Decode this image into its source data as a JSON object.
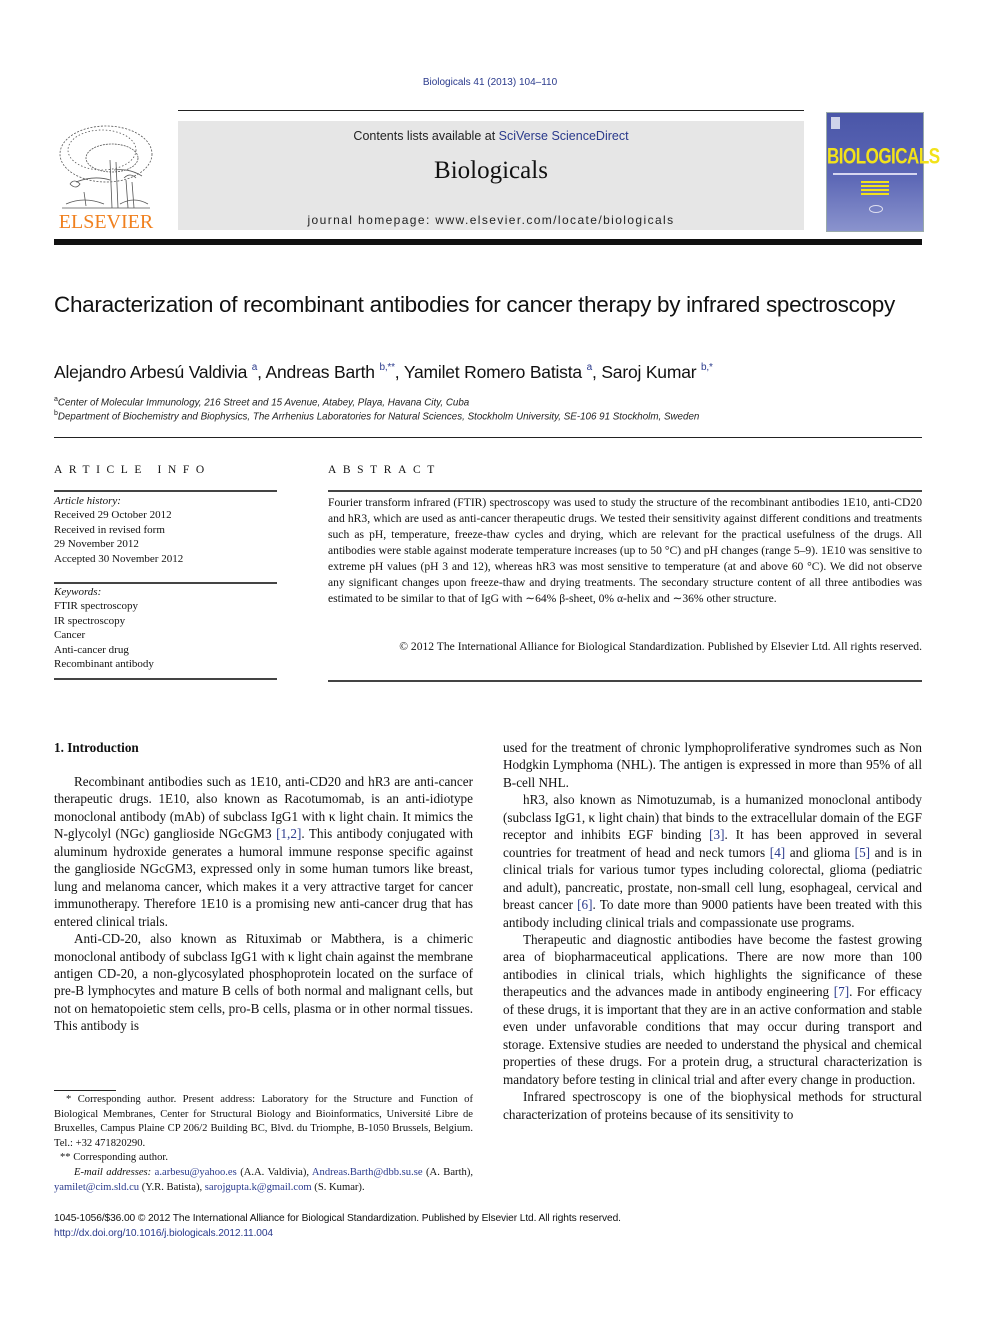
{
  "header": {
    "citation": "Biologicals 41 (2013) 104–110",
    "publisher_logo": {
      "icon": "elsevier-tree-icon",
      "wordmark": "ELSEVIER",
      "color": "#f0801e"
    },
    "contents_prefix": "Contents lists available at ",
    "contents_link": "SciVerse ScienceDirect",
    "journal_name": "Biologicals",
    "homepage": "journal homepage: www.elsevier.com/locate/biologicals",
    "cover": {
      "icon": "journal-cover-icon",
      "title": "BIOLOGICALS",
      "background": "#4a56a8",
      "title_color": "#f2e21a"
    }
  },
  "article": {
    "title": "Characterization of recombinant antibodies for cancer therapy by infrared spectroscopy",
    "authors": [
      {
        "name": "Alejandro Arbesú Valdivia",
        "sup": "a",
        "sep": ", "
      },
      {
        "name": "Andreas Barth",
        "sup": "b,**",
        "sep": ", "
      },
      {
        "name": "Yamilet Romero Batista",
        "sup": "a",
        "sep": ", "
      },
      {
        "name": "Saroj Kumar",
        "sup": "b,*",
        "sep": ""
      }
    ],
    "affiliations": [
      {
        "label": "a",
        "text": "Center of Molecular Immunology, 216 Street and 15 Avenue, Atabey, Playa, Havana City, Cuba"
      },
      {
        "label": "b",
        "text": "Department of Biochemistry and Biophysics, The Arrhenius Laboratories for Natural Sciences, Stockholm University, SE-106 91 Stockholm, Sweden"
      }
    ]
  },
  "article_info": {
    "heading": "ARTICLE INFO",
    "history_label": "Article history:",
    "history": [
      "Received 29 October 2012",
      "Received in revised form",
      "29 November 2012",
      "Accepted 30 November 2012"
    ],
    "keywords_label": "Keywords:",
    "keywords": [
      "FTIR spectroscopy",
      "IR spectroscopy",
      "Cancer",
      "Anti-cancer drug",
      "Recombinant antibody"
    ]
  },
  "abstract": {
    "heading": "ABSTRACT",
    "text": "Fourier transform infrared (FTIR) spectroscopy was used to study the structure of the recombinant antibodies 1E10, anti-CD20 and hR3, which are used as anti-cancer therapeutic drugs. We tested their sensitivity against different conditions and treatments such as pH, temperature, freeze-thaw cycles and drying, which are relevant for the practical usefulness of the drugs. All antibodies were stable against moderate temperature increases (up to 50 °C) and pH changes (range 5–9). 1E10 was sensitive to extreme pH values (pH 3 and 12), whereas hR3 was most sensitive to temperature (at and above 60 °C). We did not observe any significant changes upon freeze-thaw and drying treatments. The secondary structure content of all three antibodies was estimated to be similar to that of IgG with ∼64% β-sheet, 0% α-helix and ∼36% other structure.",
    "copyright": "© 2012 The International Alliance for Biological Standardization. Published by Elsevier Ltd. All rights reserved."
  },
  "body": {
    "section_heading": "1.  Introduction",
    "left_paragraphs": [
      {
        "parts": [
          {
            "t": "Recombinant antibodies such as 1E10, anti-CD20 and hR3 are anti-cancer therapeutic drugs. 1E10, also known as Racotumomab, is an anti-idiotype monoclonal antibody (mAb) of subclass IgG1 with κ light chain. It mimics the N-glycolyl (NGc) ganglioside NGcGM3 "
          },
          {
            "ref": "[1,2]"
          },
          {
            "t": ". This antibody conjugated with aluminum hydroxide generates a humoral immune response specific against the ganglioside NGcGM3, expressed only in some human tumors like breast, lung and melanoma cancer, which makes it a very attractive target for cancer immunotherapy. Therefore 1E10 is a promising new anti-cancer drug that has entered clinical trials."
          }
        ]
      },
      {
        "parts": [
          {
            "t": "Anti-CD-20, also known as Rituximab or Mabthera, is a chimeric monoclonal antibody of subclass IgG1 with κ light chain against the membrane antigen CD-20, a non-glycosylated phosphoprotein located on the surface of pre-B lymphocytes and mature B cells of both normal and malignant cells, but not on hematopoietic stem cells, pro-B cells, plasma or in other normal tissues. This antibody is"
          }
        ]
      }
    ],
    "right_paragraphs": [
      {
        "continued": true,
        "parts": [
          {
            "t": "used for the treatment of chronic lymphoproliferative syndromes such as Non Hodgkin Lymphoma (NHL). The antigen is expressed in more than 95% of all B-cell NHL."
          }
        ]
      },
      {
        "parts": [
          {
            "t": "hR3, also known as Nimotuzumab, is a humanized monoclonal antibody (subclass IgG1, κ light chain) that binds to the extracellular domain of the EGF receptor and inhibits EGF binding "
          },
          {
            "ref": "[3]"
          },
          {
            "t": ". It has been approved in several countries for treatment of head and neck tumors "
          },
          {
            "ref": "[4]"
          },
          {
            "t": " and glioma "
          },
          {
            "ref": "[5]"
          },
          {
            "t": " and is in clinical trials for various tumor types including colorectal, glioma (pediatric and adult), pancreatic, prostate, non-small cell lung, esophageal, cervical and breast cancer "
          },
          {
            "ref": "[6]"
          },
          {
            "t": ". To date more than 9000 patients have been treated with this antibody including clinical trials and compassionate use programs."
          }
        ]
      },
      {
        "parts": [
          {
            "t": "Therapeutic and diagnostic antibodies have become the fastest growing area of biopharmaceutical applications. There are now more than 100 antibodies in clinical trials, which highlights the significance of these therapeutics and the advances made in antibody engineering "
          },
          {
            "ref": "[7]"
          },
          {
            "t": ". For efficacy of these drugs, it is important that they are in an active conformation and stable even under unfavorable conditions that may occur during transport and storage. Extensive studies are needed to understand the physical and chemical properties of these drugs. For a protein drug, a structural characterization is mandatory before testing in clinical trial and after every change in production."
          }
        ]
      },
      {
        "parts": [
          {
            "t": "Infrared spectroscopy is one of the biophysical methods for structural characterization of proteins because of its sensitivity to"
          }
        ]
      }
    ]
  },
  "footnotes": {
    "note1": "* Corresponding author. Present address: Laboratory for the Structure and Function of Biological Membranes, Center for Structural Biology and Bioinformatics, Université Libre de Bruxelles, Campus Plaine CP 206/2 Building BC, Blvd. du Triomphe, B-1050 Brussels, Belgium. Tel.: +32 471820290.",
    "note2": "** Corresponding author.",
    "email_label": "E-mail addresses:",
    "emails": [
      {
        "email": "a.arbesu@yahoo.es",
        "who": " (A.A. Valdivia), "
      },
      {
        "email": "Andreas.Barth@dbb.su.se",
        "who": " (A. Barth), "
      },
      {
        "email": "yamilet@cim.sld.cu",
        "who": " (Y.R. Batista), "
      },
      {
        "email": "sarojgupta.k@gmail.com",
        "who": " (S. Kumar)."
      }
    ]
  },
  "footer": {
    "issn_line": "1045-1056/$36.00 © 2012 The International Alliance for Biological Standardization. Published by Elsevier Ltd. All rights reserved.",
    "doi": "http://dx.doi.org/10.1016/j.biologicals.2012.11.004"
  },
  "colors": {
    "link": "#2a3a8c",
    "header_box": "#e6e6e6",
    "elsevier_orange": "#f0801e"
  }
}
